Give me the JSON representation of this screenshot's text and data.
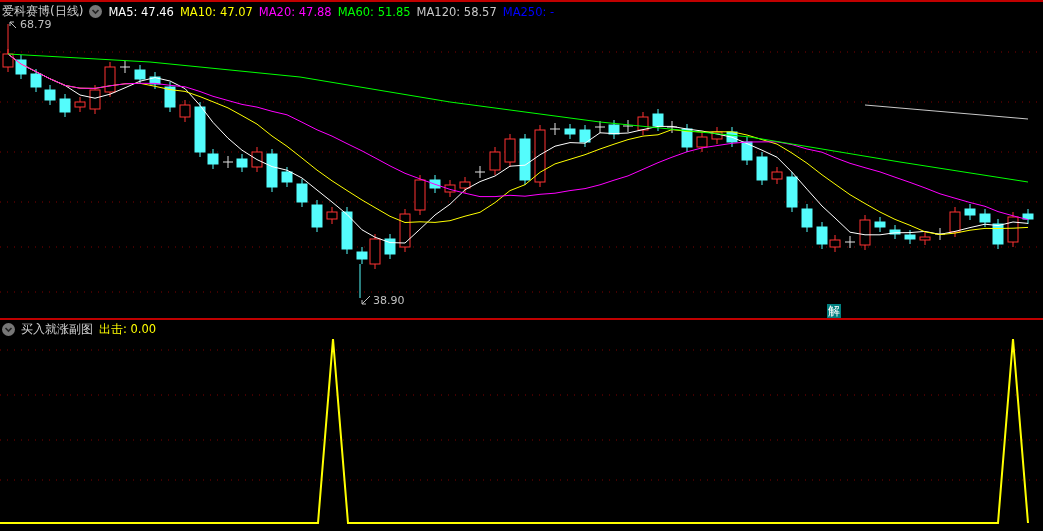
{
  "main_chart": {
    "title": "爱科赛博(日线)",
    "moving_averages": [
      {
        "label": "MA5: 47.46",
        "color": "#ffffff"
      },
      {
        "label": "MA10: 47.07",
        "color": "#ffff00"
      },
      {
        "label": "MA20: 47.88",
        "color": "#ff00ff"
      },
      {
        "label": "MA60: 51.85",
        "color": "#00ff00"
      },
      {
        "label": "MA120: 58.57",
        "color": "#c8c8c8"
      },
      {
        "label": "MA250: -",
        "color": "#0000ff"
      }
    ],
    "high_label": "68.79",
    "low_label": "38.90",
    "badge": "解"
  },
  "sub_chart": {
    "title": "买入就涨副图",
    "indicator": "出击: 0.00"
  }
}
